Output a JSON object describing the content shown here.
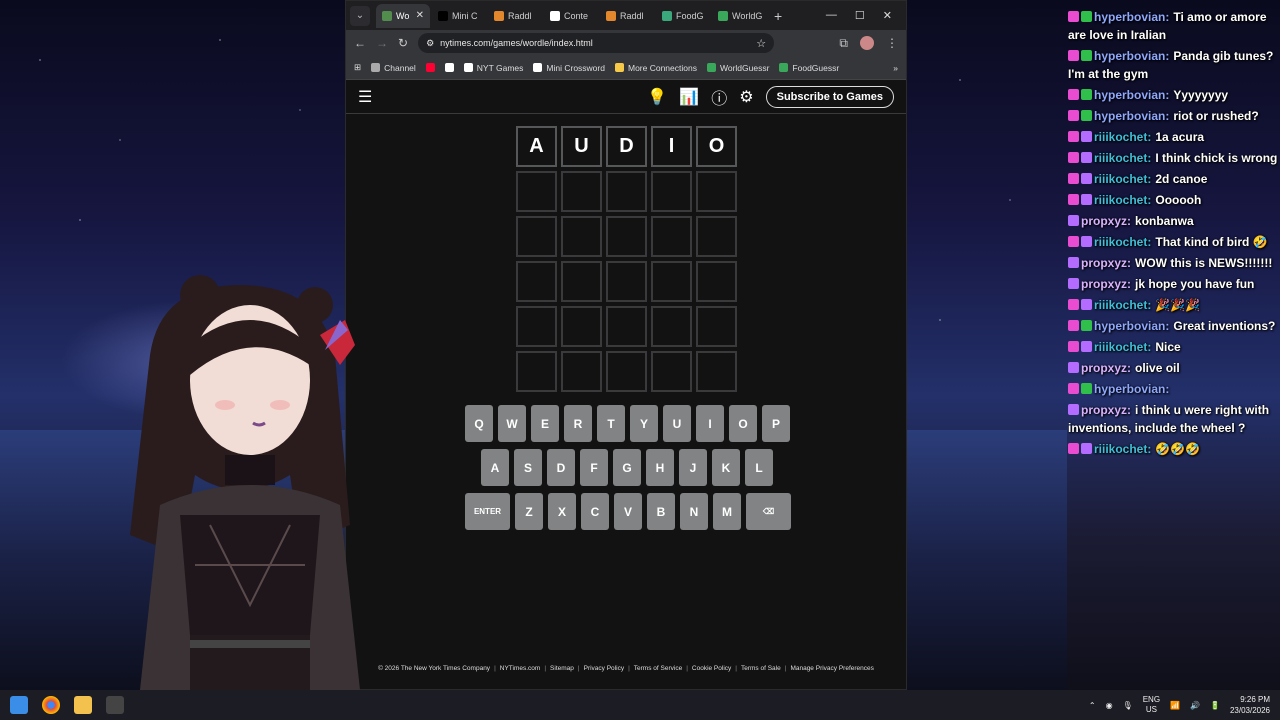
{
  "browser": {
    "tabs": [
      {
        "label": "Wo",
        "active": true,
        "icon_color": "#538d4e"
      },
      {
        "label": "Mini C",
        "active": false,
        "icon_color": "#000000"
      },
      {
        "label": "Raddl",
        "active": false,
        "icon_color": "#e3872d"
      },
      {
        "label": "Conte",
        "active": false,
        "icon_color": "#ffffff"
      },
      {
        "label": "Raddl",
        "active": false,
        "icon_color": "#e3872d"
      },
      {
        "label": "FoodG",
        "active": false,
        "icon_color": "#3aa87a"
      },
      {
        "label": "WorldG",
        "active": false,
        "icon_color": "#3aa85a"
      }
    ],
    "url": "nytimes.com/games/wordle/index.html",
    "bookmarks": [
      {
        "label": "Channel",
        "icon": "folder-icon"
      },
      {
        "label": "",
        "icon": "youtube-icon"
      },
      {
        "label": "",
        "icon": "x-icon"
      },
      {
        "label": "NYT Games",
        "icon": "nyt-icon"
      },
      {
        "label": "Mini Crossword",
        "icon": "nyt-icon"
      },
      {
        "label": "More Connections",
        "icon": "grid-icon"
      },
      {
        "label": "WorldGuessr",
        "icon": "globe-icon"
      },
      {
        "label": "FoodGuessr",
        "icon": "globe-icon"
      }
    ]
  },
  "nyt": {
    "subscribe_label": "Subscribe to Games",
    "grid": [
      [
        "A",
        "U",
        "D",
        "I",
        "O"
      ],
      [
        "",
        "",
        "",
        "",
        ""
      ],
      [
        "",
        "",
        "",
        "",
        ""
      ],
      [
        "",
        "",
        "",
        "",
        ""
      ],
      [
        "",
        "",
        "",
        "",
        ""
      ],
      [
        "",
        "",
        "",
        "",
        ""
      ]
    ],
    "keyboard": [
      [
        "Q",
        "W",
        "E",
        "R",
        "T",
        "Y",
        "U",
        "I",
        "O",
        "P"
      ],
      [
        "A",
        "S",
        "D",
        "F",
        "G",
        "H",
        "J",
        "K",
        "L"
      ],
      [
        "ENTER",
        "Z",
        "X",
        "C",
        "V",
        "B",
        "N",
        "M",
        "⌫"
      ]
    ],
    "footer": [
      "© 2026 The New York Times Company",
      "NYTimes.com",
      "Sitemap",
      "Privacy Policy",
      "Terms of Service",
      "Cookie Policy",
      "Terms of Sale",
      "Manage Privacy Preferences"
    ]
  },
  "chat": [
    {
      "user": "hyperbovian:",
      "color": "#8fa8ff",
      "text": "Ti amo or amore are love in Iralian"
    },
    {
      "user": "hyperbovian:",
      "color": "#8fa8ff",
      "text": "Panda gib tunes? I'm at the gym"
    },
    {
      "user": "hyperbovian:",
      "color": "#8fa8ff",
      "text": "Yyyyyyyy"
    },
    {
      "user": "hyperbovian:",
      "color": "#8fa8ff",
      "text": "riot or rushed?"
    },
    {
      "user": "riiikochet:",
      "color": "#3fbfd8",
      "text": "1a acura"
    },
    {
      "user": "riiikochet:",
      "color": "#3fbfd8",
      "text": "I think chick is wrong"
    },
    {
      "user": "riiikochet:",
      "color": "#3fbfd8",
      "text": "2d canoe"
    },
    {
      "user": "riiikochet:",
      "color": "#3fbfd8",
      "text": "Oooooh"
    },
    {
      "user": "propxyz:",
      "color": "#d9b3ff",
      "text": "konbanwa"
    },
    {
      "user": "riiikochet:",
      "color": "#3fbfd8",
      "text": "That kind of bird 🤣"
    },
    {
      "user": "propxyz:",
      "color": "#d9b3ff",
      "text": "WOW this is NEWS!!!!!!!"
    },
    {
      "user": "propxyz:",
      "color": "#d9b3ff",
      "text": "jk hope you have fun"
    },
    {
      "user": "riiikochet:",
      "color": "#3fbfd8",
      "text": "🎉🎉🎉"
    },
    {
      "user": "hyperbovian:",
      "color": "#8fa8ff",
      "text": "Great inventions?"
    },
    {
      "user": "riiikochet:",
      "color": "#3fbfd8",
      "text": "Nice"
    },
    {
      "user": "propxyz:",
      "color": "#d9b3ff",
      "text": "olive oil"
    },
    {
      "user": "hyperbovian:",
      "color": "#8fa8ff",
      "text": ""
    },
    {
      "user": "propxyz:",
      "color": "#d9b3ff",
      "text": "i think u were right with inventions, include the wheel ?"
    },
    {
      "user": "riiikochet:",
      "color": "#3fbfd8",
      "text": "🤣🤣🤣"
    }
  ],
  "taskbar": {
    "lang": "ENG",
    "region": "US",
    "time": "9:26 PM",
    "date": "23/03/2026"
  }
}
